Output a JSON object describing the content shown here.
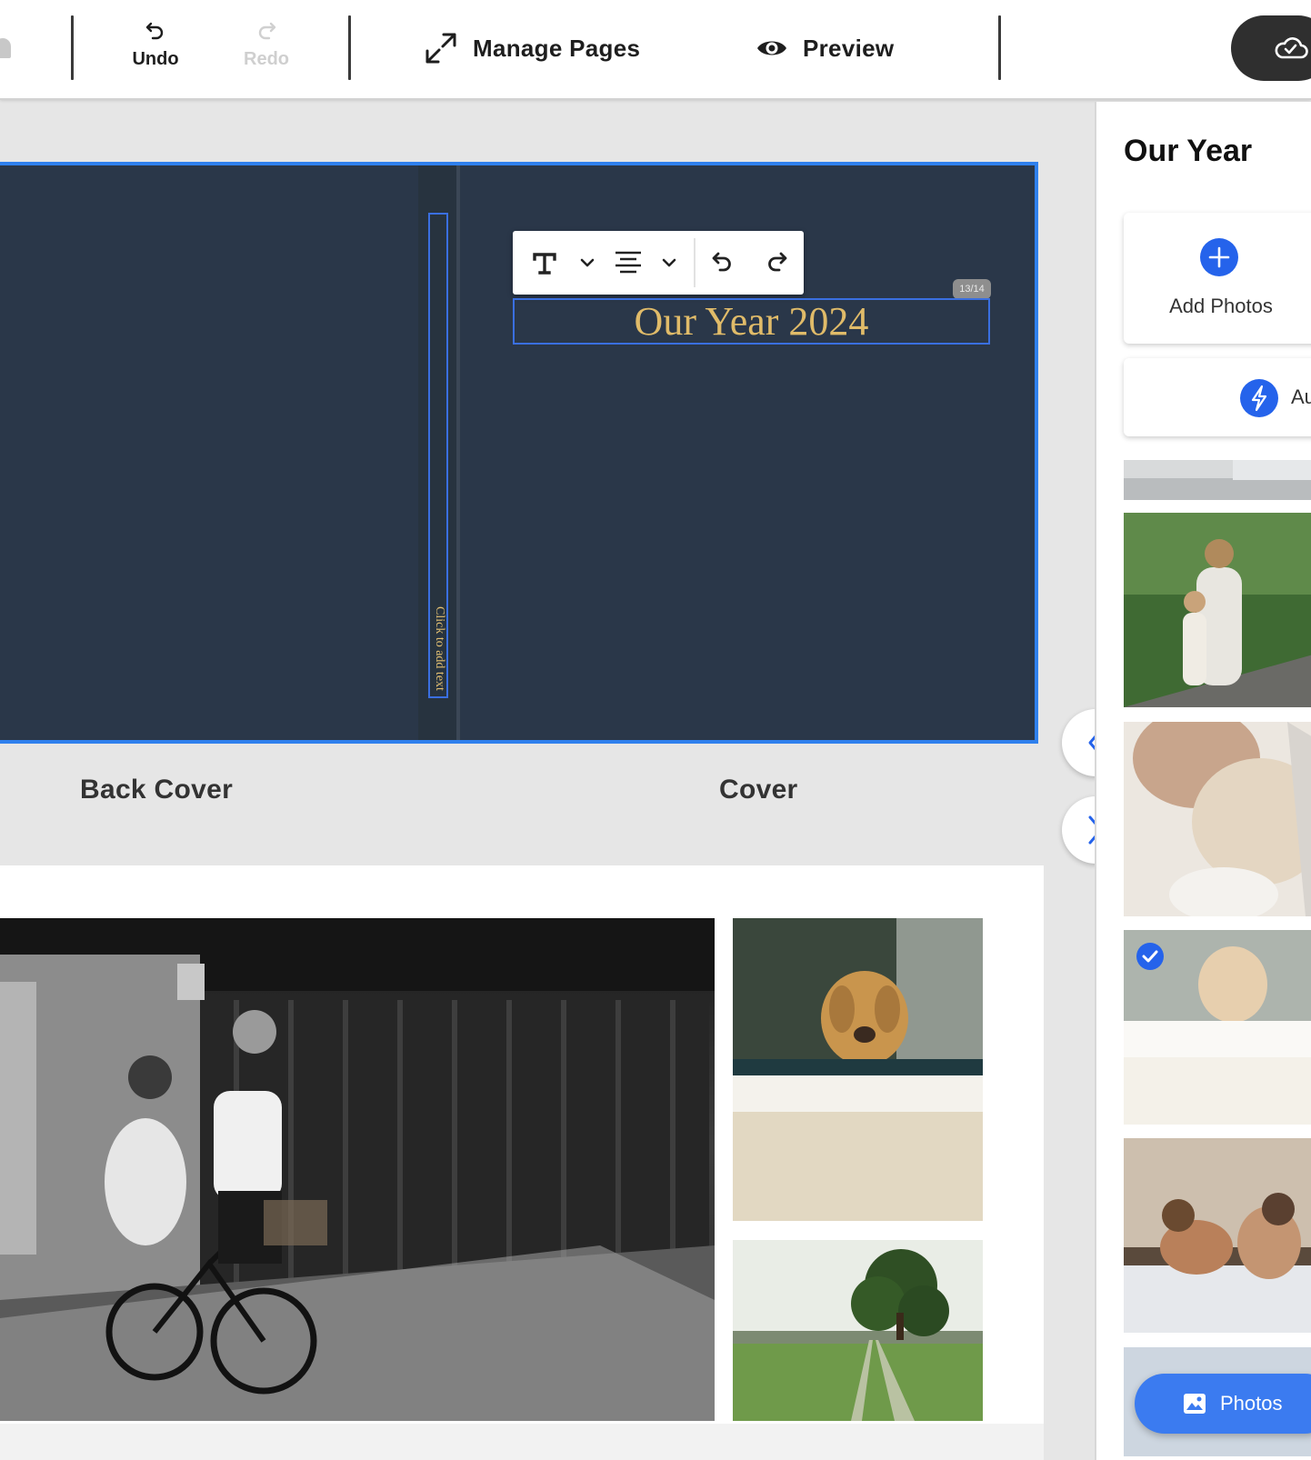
{
  "toolbar": {
    "undo_label": "Undo",
    "redo_label": "Redo",
    "manage_pages_label": "Manage Pages",
    "preview_label": "Preview"
  },
  "editor": {
    "title_text": "Our Year 2024",
    "char_count": "13/14",
    "spine_placeholder": "Click to add text",
    "title_color": "#e0bb69",
    "cover_color": "#2a3749",
    "selection_color": "#2f80ed"
  },
  "pages": {
    "back_cover_label": "Back Cover",
    "cover_label": "Cover"
  },
  "panel": {
    "title": "Our Year",
    "add_photos_label": "Add Photos",
    "autofill_label": "Au",
    "photos_button_label": "Photos"
  },
  "icons": [
    "undo-icon",
    "redo-icon",
    "expand-icon",
    "eye-icon",
    "cloud-save-icon",
    "text-style-icon",
    "chevron-down-icon",
    "align-center-icon",
    "plus-icon",
    "lightning-icon",
    "check-icon",
    "image-icon",
    "chevron-left-icon",
    "chevron-right-icon"
  ],
  "accent": "#2563eb"
}
